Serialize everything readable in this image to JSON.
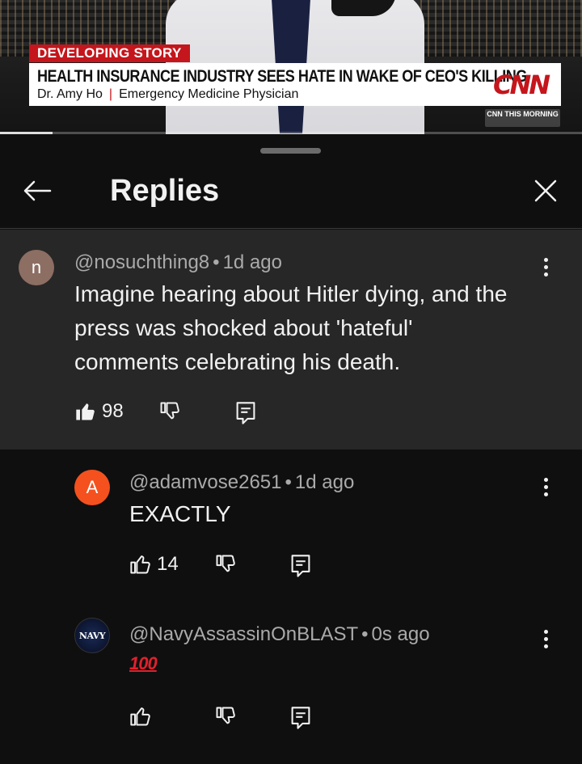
{
  "video": {
    "chyron_tag": "DEVELOPING STORY",
    "headline": "HEALTH INSURANCE INDUSTRY SEES HATE IN WAKE OF CEO'S KILLING",
    "guest_name": "Dr. Amy Ho",
    "guest_separator": "|",
    "guest_title": "Emergency Medicine Physician",
    "network_logo": "CNN",
    "show_bug": "CNN THIS MORNING",
    "progress": 0.09,
    "accent_color": "#c4161c"
  },
  "sheet": {
    "title": "Replies",
    "back_icon": "arrow-left-icon",
    "close_icon": "close-icon"
  },
  "comments": [
    {
      "avatar_letter": "n",
      "avatar_color": "#8d6e63",
      "author": "@nosuchthing8",
      "dot": "•",
      "age": "1d ago",
      "text": "Imagine hearing about Hitler dying, and the press was shocked about 'hateful' comments celebrating his death.",
      "likes": "98",
      "liked": true
    },
    {
      "avatar_letter": "A",
      "avatar_color": "#f4511e",
      "author": "@adamvose2651",
      "dot": "•",
      "age": "1d ago",
      "text": "EXACTLY",
      "likes": "14",
      "liked": false
    },
    {
      "avatar_letter": "NAVY",
      "avatar_color": "#0c1530",
      "author": "@NavyAssassinOnBLAST",
      "dot": "•",
      "age": "0s ago",
      "text": "100",
      "likes": "",
      "liked": false
    }
  ]
}
